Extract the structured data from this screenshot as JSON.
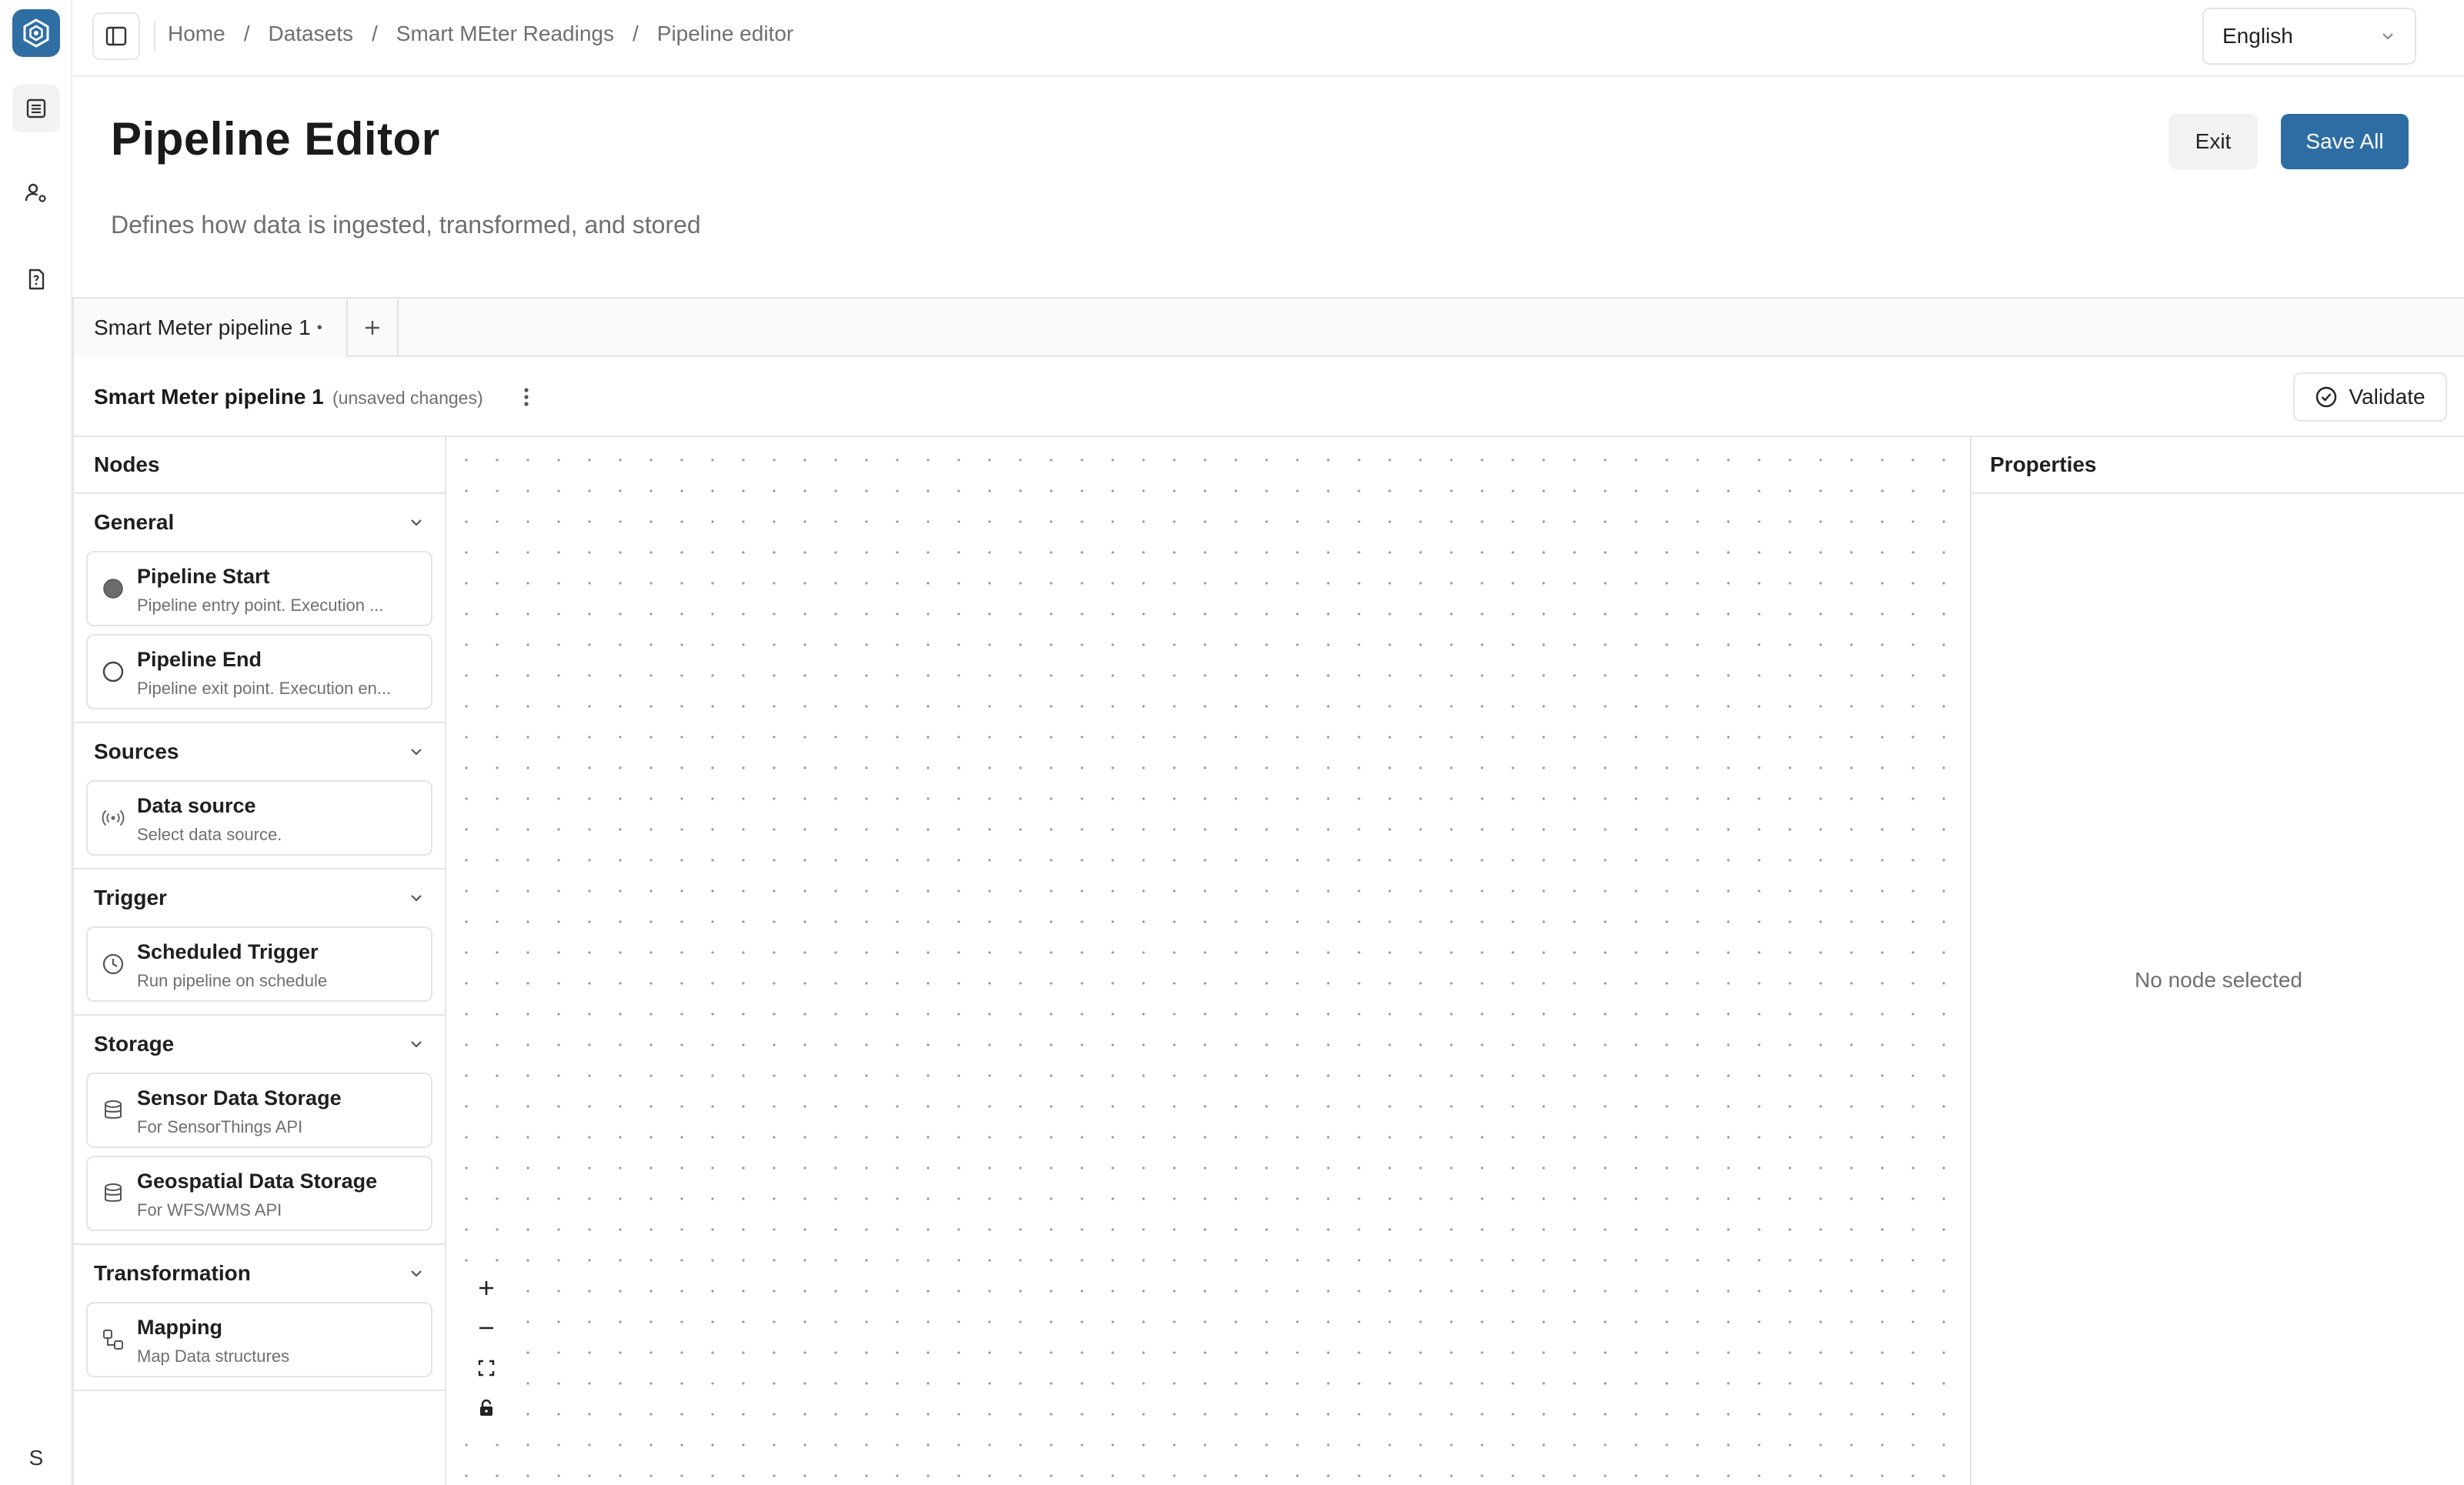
{
  "breadcrumb": {
    "items": [
      "Home",
      "Datasets",
      "Smart MEter Readings",
      "Pipeline editor"
    ],
    "separator": "/"
  },
  "language": {
    "selected": "English"
  },
  "header": {
    "title": "Pipeline Editor",
    "description": "Defines how data is ingested, transformed, and stored",
    "exit_label": "Exit",
    "save_label": "Save All"
  },
  "tabs": [
    {
      "label": "Smart Meter pipeline 1",
      "modified_marker": "•"
    }
  ],
  "pipeline": {
    "name": "Smart Meter pipeline 1",
    "status": "(unsaved changes)",
    "validate_label": "Validate"
  },
  "nodes_panel": {
    "title": "Nodes",
    "groups": [
      {
        "title": "General",
        "items": [
          {
            "title": "Pipeline Start",
            "subtitle": "Pipeline entry point. Execution ...",
            "icon": "filled-circle-icon"
          },
          {
            "title": "Pipeline End",
            "subtitle": "Pipeline exit point. Execution en...",
            "icon": "hollow-circle-icon"
          }
        ]
      },
      {
        "title": "Sources",
        "items": [
          {
            "title": "Data source",
            "subtitle": "Select data source.",
            "icon": "broadcast-icon"
          }
        ]
      },
      {
        "title": "Trigger",
        "items": [
          {
            "title": "Scheduled Trigger",
            "subtitle": "Run pipeline on schedule",
            "icon": "clock-icon"
          }
        ]
      },
      {
        "title": "Storage",
        "items": [
          {
            "title": "Sensor Data Storage",
            "subtitle": "For SensorThings API",
            "icon": "database-icon"
          },
          {
            "title": "Geospatial Data Storage",
            "subtitle": "For WFS/WMS API",
            "icon": "database-icon"
          }
        ]
      },
      {
        "title": "Transformation",
        "items": [
          {
            "title": "Mapping",
            "subtitle": "Map Data structures",
            "icon": "mapping-icon"
          }
        ]
      }
    ]
  },
  "properties": {
    "title": "Properties",
    "empty_text": "No node selected"
  },
  "user": {
    "initial": "S"
  },
  "colors": {
    "accent": "#2e6da4",
    "border": "#e4e4e4",
    "muted_text": "#6f6f6f"
  }
}
